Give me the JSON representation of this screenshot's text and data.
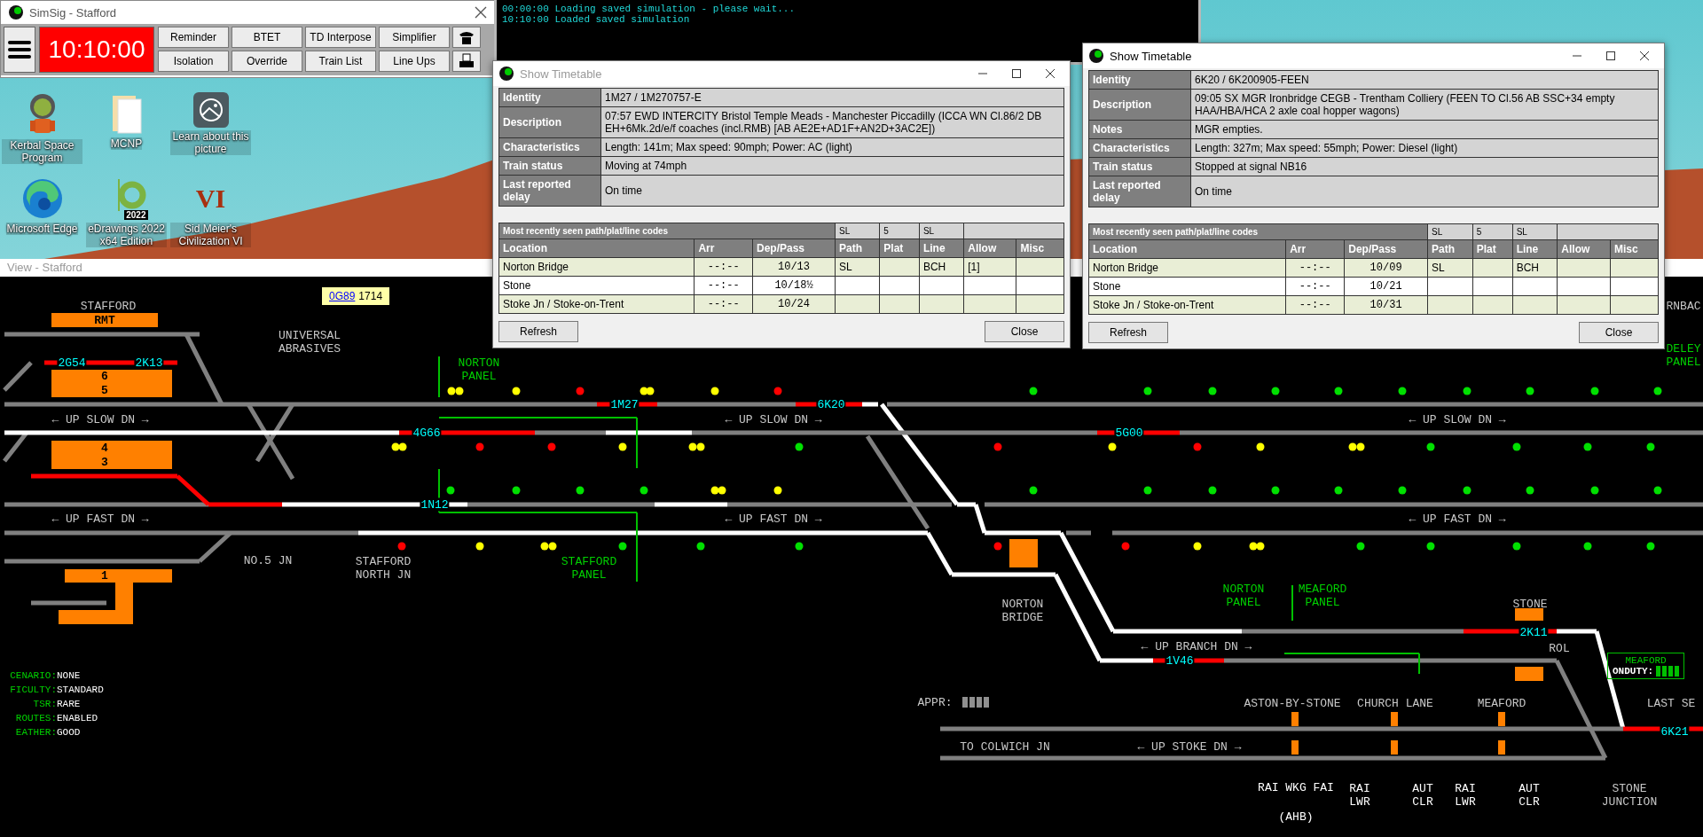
{
  "toolbar": {
    "title": "SimSig - Stafford",
    "clock": "10:10:00",
    "buttons": [
      "Reminder",
      "BTET",
      "TD Interpose",
      "Simplifier",
      "Isolation",
      "Override",
      "Train List",
      "Line Ups"
    ]
  },
  "desktop_icons": [
    {
      "label": "Kerbal Space Program",
      "kind": "astronaut"
    },
    {
      "label": "MCNP",
      "kind": "folder"
    },
    {
      "label": "Learn about this picture",
      "kind": "picture"
    },
    {
      "label": "Microsoft Edge",
      "kind": "edge"
    },
    {
      "label": "eDrawings 2022 x64 Edition",
      "kind": "edrawings",
      "badge": "2022"
    },
    {
      "label": "Sid Meier's Civilization VI",
      "kind": "civ",
      "badge": "VI"
    }
  ],
  "console": {
    "lines": [
      "00:00:00 Loading saved simulation - please wait...",
      "10:10:00 Loaded saved simulation"
    ]
  },
  "view": {
    "title": "View - Stafford",
    "tooltip": {
      "link": "0G89",
      "text": "1714"
    },
    "status": [
      {
        "label": "CENARIO:",
        "value": "NONE"
      },
      {
        "label": "FICULTY:",
        "value": "STANDARD"
      },
      {
        "label": "TSR:",
        "value": "RARE"
      },
      {
        "label": "ROUTES:",
        "value": "ENABLED"
      },
      {
        "label": "EATHER:",
        "value": "GOOD"
      }
    ],
    "duty_box": {
      "title": "MEAFORD",
      "label": "ONDUTY:"
    },
    "labels": [
      {
        "kind": "location",
        "text": "STAFFORD"
      },
      {
        "kind": "platform",
        "text": "RMT"
      },
      {
        "kind": "berth",
        "text": "2G54"
      },
      {
        "kind": "berth",
        "text": "2K13"
      },
      {
        "kind": "platform",
        "text": "6"
      },
      {
        "kind": "platform",
        "text": "5"
      },
      {
        "kind": "location",
        "text": "UNIVERSAL\nABRASIVES"
      },
      {
        "kind": "panel",
        "text": "NORTON\nPANEL"
      },
      {
        "kind": "direction",
        "text": "← UP SLOW DN →"
      },
      {
        "kind": "berth",
        "text": "4G66"
      },
      {
        "kind": "berth",
        "text": "1M27"
      },
      {
        "kind": "berth",
        "text": "6K20"
      },
      {
        "kind": "direction",
        "text": "← UP SLOW DN →"
      },
      {
        "kind": "platform",
        "text": "4"
      },
      {
        "kind": "platform",
        "text": "3"
      },
      {
        "kind": "berth",
        "text": "1N12"
      },
      {
        "kind": "direction",
        "text": "← UP FAST DN →"
      },
      {
        "kind": "direction",
        "text": "← UP FAST DN →"
      },
      {
        "kind": "platform",
        "text": "1"
      },
      {
        "kind": "location",
        "text": "NO.5 JN"
      },
      {
        "kind": "location",
        "text": "STAFFORD\nNORTH JN"
      },
      {
        "kind": "panel",
        "text": "STAFFORD\nPANEL"
      },
      {
        "kind": "berth",
        "text": "5G00"
      },
      {
        "kind": "direction",
        "text": "← UP SLOW DN →"
      },
      {
        "kind": "direction",
        "text": "← UP FAST DN →"
      },
      {
        "kind": "location",
        "text": "NORTON\nBRIDGE"
      },
      {
        "kind": "panel",
        "text": "NORTON\nPANEL"
      },
      {
        "kind": "panel",
        "text": "MEAFORD\nPANEL"
      },
      {
        "kind": "location",
        "text": "STONE"
      },
      {
        "kind": "berth",
        "text": "2K11"
      },
      {
        "kind": "location",
        "text": "ROL"
      },
      {
        "kind": "direction",
        "text": "← UP BRANCH DN →"
      },
      {
        "kind": "berth",
        "text": "1V46"
      },
      {
        "kind": "location",
        "text": "APPR:"
      },
      {
        "kind": "location",
        "text": "ASTON-BY-STONE"
      },
      {
        "kind": "location",
        "text": "CHURCH LANE"
      },
      {
        "kind": "location",
        "text": "MEAFORD"
      },
      {
        "kind": "location",
        "text": "LAST SE"
      },
      {
        "kind": "location",
        "text": "TO COLWICH JN"
      },
      {
        "kind": "direction",
        "text": "← UP STOKE DN →"
      },
      {
        "kind": "berth",
        "text": "6K21"
      },
      {
        "kind": "crossing",
        "text": "RAI WKG FAI"
      },
      {
        "kind": "crossing",
        "text": "(AHB)"
      },
      {
        "kind": "crossing",
        "text": "RAI\nLWR"
      },
      {
        "kind": "crossing",
        "text": "AUT\nCLR"
      },
      {
        "kind": "crossing",
        "text": "RAI\nLWR"
      },
      {
        "kind": "crossing",
        "text": "AUT\nCLR"
      },
      {
        "kind": "location",
        "text": "STONE\nJUNCTION"
      },
      {
        "kind": "location",
        "text": "RNBAC"
      },
      {
        "kind": "panel",
        "text": "DELEY\nPANEL"
      }
    ],
    "signal_rows": [
      {
        "signals": [
          {
            "color": "#ffff00"
          },
          {
            "color": "#ffff00"
          },
          {
            "color": "#ffff00"
          },
          {
            "color": "#ff0000"
          },
          {
            "color": "#ffff00"
          },
          {
            "color": "#ffff00"
          },
          {
            "color": "#ffff00"
          },
          {
            "color": "#ff0000"
          },
          {
            "color": "#00e000"
          },
          {
            "color": "#00e000"
          },
          {
            "color": "#00e000"
          },
          {
            "color": "#00e000"
          },
          {
            "color": "#00e000"
          },
          {
            "color": "#00e000"
          },
          {
            "color": "#00e000"
          },
          {
            "color": "#00e000"
          },
          {
            "color": "#00e000"
          },
          {
            "color": "#00e000"
          }
        ]
      },
      {
        "signals": [
          {
            "color": "#ffff00"
          },
          {
            "color": "#ffff00"
          },
          {
            "color": "#ff0000"
          },
          {
            "color": "#ff0000"
          },
          {
            "color": "#ffff00"
          },
          {
            "color": "#ffff00"
          },
          {
            "color": "#ffff00"
          },
          {
            "color": "#00e000"
          },
          {
            "color": "#ff0000"
          },
          {
            "color": "#ffff00"
          },
          {
            "color": "#ff0000"
          },
          {
            "color": "#ffff00"
          },
          {
            "color": "#ffff00"
          },
          {
            "color": "#ffff00"
          },
          {
            "color": "#00e000"
          },
          {
            "color": "#00e000"
          },
          {
            "color": "#00e000"
          },
          {
            "color": "#00e000"
          }
        ]
      },
      {
        "signals": [
          {
            "color": "#00e000"
          },
          {
            "color": "#00e000"
          },
          {
            "color": "#00e000"
          },
          {
            "color": "#00e000"
          },
          {
            "color": "#ffff00"
          },
          {
            "color": "#ffff00"
          },
          {
            "color": "#ffff00"
          },
          {
            "color": "#00e000"
          },
          {
            "color": "#00e000"
          },
          {
            "color": "#00e000"
          },
          {
            "color": "#00e000"
          },
          {
            "color": "#00e000"
          },
          {
            "color": "#00e000"
          },
          {
            "color": "#00e000"
          },
          {
            "color": "#00e000"
          },
          {
            "color": "#00e000"
          },
          {
            "color": "#00e000"
          }
        ]
      },
      {
        "signals": [
          {
            "color": "#ff0000"
          },
          {
            "color": "#ffff00"
          },
          {
            "color": "#ffff00"
          },
          {
            "color": "#ffff00"
          },
          {
            "color": "#00e000"
          },
          {
            "color": "#00e000"
          },
          {
            "color": "#00e000"
          },
          {
            "color": "#ff0000"
          },
          {
            "color": "#ff0000"
          },
          {
            "color": "#ffff00"
          },
          {
            "color": "#ffff00"
          },
          {
            "color": "#ffff00"
          },
          {
            "color": "#00e000"
          },
          {
            "color": "#00e000"
          },
          {
            "color": "#00e000"
          },
          {
            "color": "#00e000"
          },
          {
            "color": "#00e000"
          }
        ]
      }
    ]
  },
  "timetables": [
    {
      "title": "Show Timetable",
      "focused": false,
      "fields": [
        {
          "label": "Identity",
          "value": "1M27 / 1M270757-E"
        },
        {
          "label": "Description",
          "value": "07:57 EWD INTERCITY Bristol Temple Meads - Manchester Piccadilly (ICCA WN Cl.86/2 DB EH+6Mk.2d/e/f coaches (incl.RMB) [AB AE2E+AD1F+AN2D+3AC2E])"
        },
        {
          "label": "Characteristics",
          "value": "Length: 141m; Max speed: 90mph; Power: AC (light)"
        },
        {
          "label": "Train status",
          "value": "Moving at 74mph"
        },
        {
          "label": "Last reported delay",
          "value": "On time"
        }
      ],
      "codes_title": "Most recently seen path/plat/line codes",
      "codes": [
        "SL",
        "5",
        "SL"
      ],
      "columns": [
        "Location",
        "Arr",
        "Dep/Pass",
        "Path",
        "Plat",
        "Line",
        "Allow",
        "Misc"
      ],
      "rows": [
        [
          "Norton Bridge",
          "--:--",
          "10/13",
          "SL",
          "",
          "BCH",
          "[1]",
          ""
        ],
        [
          "Stone",
          "--:--",
          "10/18½",
          "",
          "",
          "",
          "",
          ""
        ],
        [
          "Stoke Jn / Stoke-on-Trent",
          "--:--",
          "10/24",
          "",
          "",
          "",
          "",
          ""
        ]
      ],
      "buttons": [
        "Refresh",
        "Close"
      ]
    },
    {
      "title": "Show Timetable",
      "focused": true,
      "fields": [
        {
          "label": "Identity",
          "value": "6K20 / 6K200905-FEEN"
        },
        {
          "label": "Description",
          "value": "09:05 SX MGR Ironbridge CEGB - Trentham Colliery (FEEN TO Cl.56 AB SSC+34 empty HAA/HBA/HCA 2 axle coal hopper wagons)"
        },
        {
          "label": "Notes",
          "value": "MGR empties."
        },
        {
          "label": "Characteristics",
          "value": "Length: 327m; Max speed: 55mph; Power: Diesel (light)"
        },
        {
          "label": "Train status",
          "value": "Stopped at signal NB16"
        },
        {
          "label": "Last reported delay",
          "value": "On time"
        }
      ],
      "codes_title": "Most recently seen path/plat/line codes",
      "codes": [
        "SL",
        "5",
        "SL"
      ],
      "columns": [
        "Location",
        "Arr",
        "Dep/Pass",
        "Path",
        "Plat",
        "Line",
        "Allow",
        "Misc"
      ],
      "rows": [
        [
          "Norton Bridge",
          "--:--",
          "10/09",
          "SL",
          "",
          "BCH",
          "",
          ""
        ],
        [
          "Stone",
          "--:--",
          "10/21",
          "",
          "",
          "",
          "",
          ""
        ],
        [
          "Stoke Jn / Stoke-on-Trent",
          "--:--",
          "10/31",
          "",
          "",
          "",
          "",
          ""
        ]
      ],
      "buttons": [
        "Refresh",
        "Close"
      ]
    }
  ]
}
